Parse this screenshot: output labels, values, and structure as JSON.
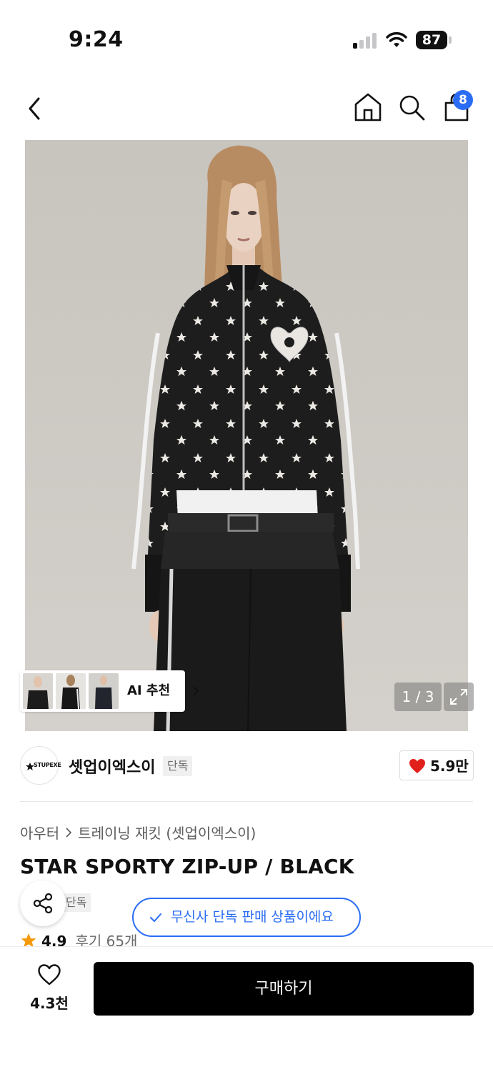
{
  "status_bar": {
    "time": "9:24",
    "battery": "87"
  },
  "nav": {
    "cart_count": "8"
  },
  "gallery": {
    "ai_label": "AI 추천",
    "page_indicator": "1 / 3"
  },
  "brand": {
    "logo_text": "STUPEXE",
    "name": "셋업이엑스이",
    "tag": "단독",
    "likes": "5.9만"
  },
  "breadcrumb": [
    "아우터",
    "트레이닝 재킷 (셋업이엑스이)"
  ],
  "product": {
    "title": "STAR SPORTY ZIP-UP / BLACK",
    "tag_partial": "단독",
    "exclusive_notice": "무신사 단독 판매 상품이에요",
    "rating": "4.9",
    "reviews": "후기 65개"
  },
  "bottom": {
    "wish_count": "4.3천",
    "buy_label": "구매하기"
  },
  "colors": {
    "accent": "#2a6df4",
    "heart": "#e1201b",
    "star": "#f59a0b",
    "buy_button": "#000000"
  },
  "icons": [
    "back-icon",
    "home-icon",
    "search-icon",
    "cart-icon",
    "chevron-right-icon",
    "expand-icon",
    "heart-icon",
    "share-icon",
    "check-icon",
    "star-icon"
  ]
}
